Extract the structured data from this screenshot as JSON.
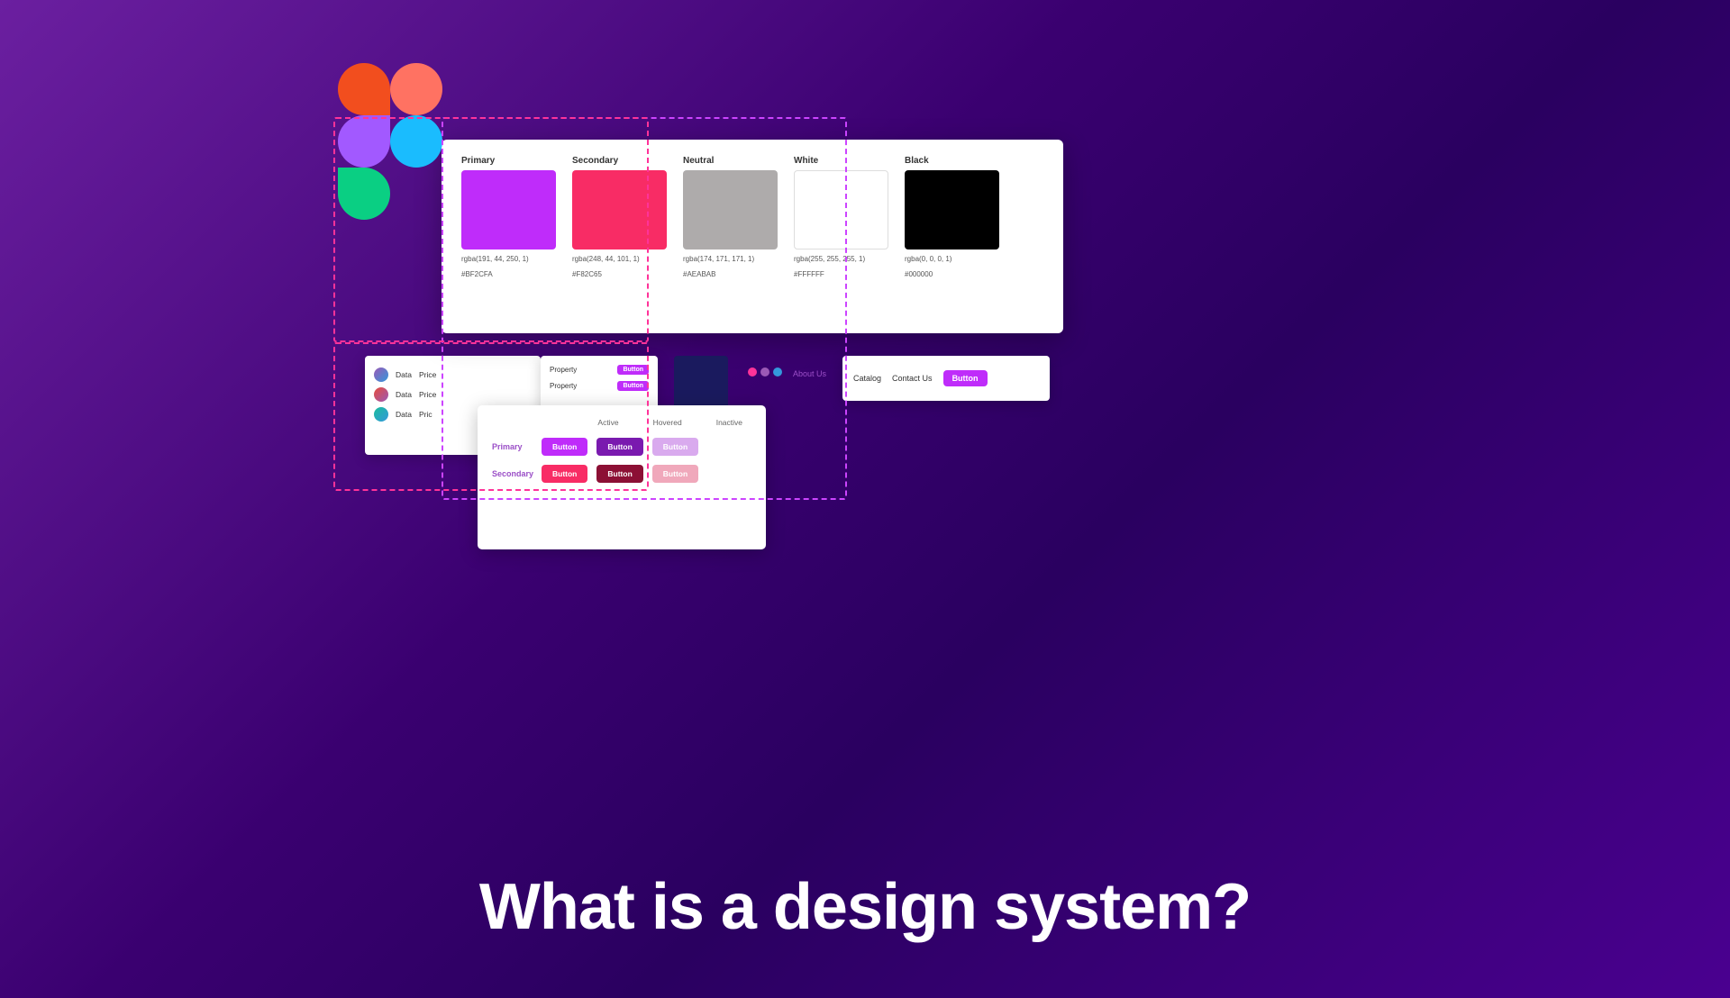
{
  "page": {
    "title": "What is a design system?",
    "background_gradient_start": "#6B1FA0",
    "background_gradient_end": "#2A0060"
  },
  "color_panel": {
    "swatches": [
      {
        "label": "Primary",
        "color": "#BF2CFA",
        "rgba": "rgba(191, 44, 250, 1)",
        "hex": "#BF2CFA"
      },
      {
        "label": "Secondary",
        "color": "#F82C65",
        "rgba": "rgba(248, 44, 101, 1)",
        "hex": "#F82C65"
      },
      {
        "label": "Neutral",
        "color": "#AEABAB",
        "rgba": "rgba(174, 171, 171, 1)",
        "hex": "#AEABAB"
      },
      {
        "label": "White",
        "color": "#FFFFFF",
        "rgba": "rgba(255, 255, 255, 1)",
        "hex": "#FFFFFF"
      },
      {
        "label": "Black",
        "color": "#000000",
        "rgba": "rgba(0, 0, 0, 1)",
        "hex": "#000000"
      }
    ]
  },
  "figma_logo": {
    "shapes": [
      "red",
      "pink",
      "purple",
      "blue",
      "green"
    ]
  },
  "table_rows": [
    {
      "label": "D"
    },
    {
      "label": "D"
    },
    {
      "label": ""
    }
  ],
  "table_data": [
    {
      "col1": "Data",
      "col2": "Price"
    },
    {
      "col1": "Data",
      "col2": "Price"
    },
    {
      "col1": "Data",
      "col2": "Pric"
    }
  ],
  "property_rows": [
    {
      "label": "Property",
      "btn": "Button"
    },
    {
      "label": "Property",
      "btn": "Button"
    }
  ],
  "button_states": {
    "headers": [
      "Active",
      "Hovered",
      "Inactive"
    ],
    "rows": [
      {
        "label": "Primary",
        "active": "Button",
        "hovered": "Button",
        "inactive": "Button"
      },
      {
        "label": "Secondary",
        "active": "Button",
        "hovered": "Button",
        "inactive": "Button"
      }
    ]
  },
  "nav": {
    "catalog": "Catalog",
    "contact": "Contact Us",
    "about": "About Us",
    "button": "Button"
  },
  "dots": [
    {
      "color": "#FF3399"
    },
    {
      "color": "#9B59B6"
    },
    {
      "color": "#3498DB"
    }
  ],
  "heading": "What is a design system?"
}
